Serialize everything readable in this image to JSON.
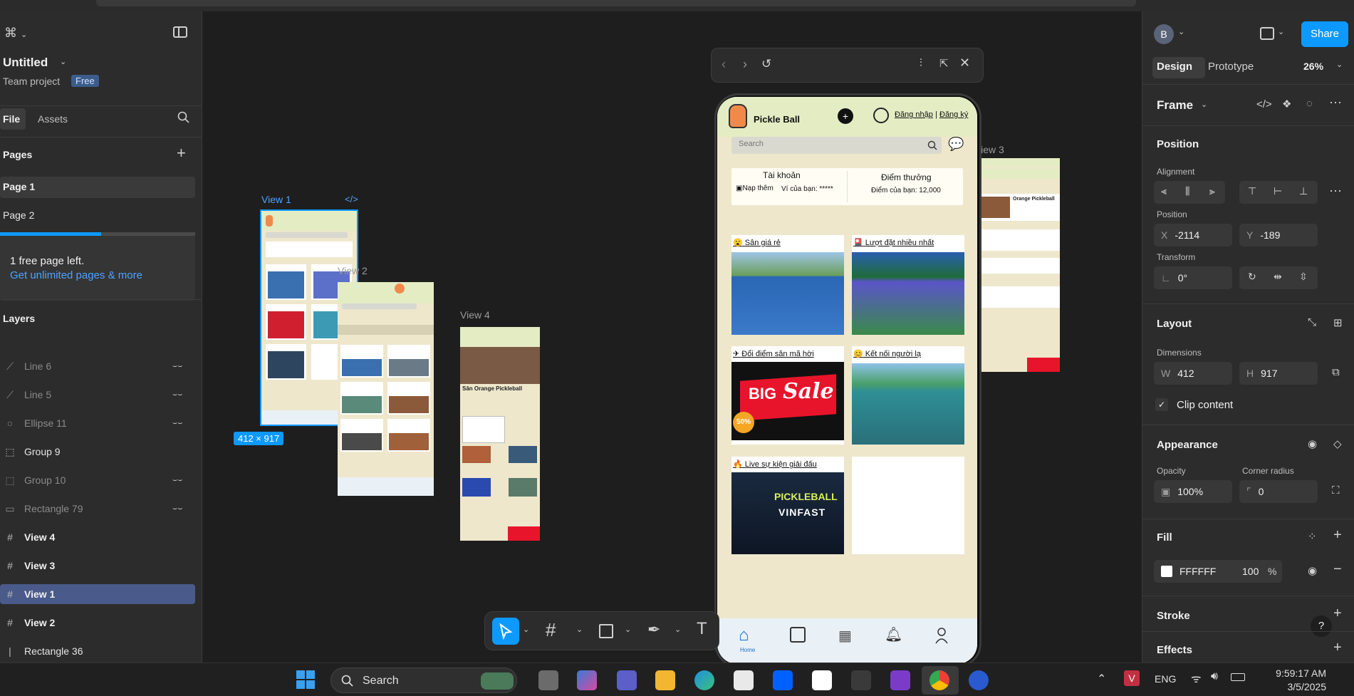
{
  "left_panel": {
    "file_name": "Untitled",
    "team": "Team project",
    "plan_badge": "Free",
    "tabs": [
      "File",
      "Assets"
    ],
    "pages_title": "Pages",
    "pages": [
      "Page 1",
      "Page 2"
    ],
    "notice": "1 free page left.",
    "notice_link": "Get unlimited pages & more",
    "usage_fraction": 0.52,
    "layers_title": "Layers",
    "layers": [
      {
        "icon": "line-icon",
        "glyph": "⟋",
        "label": "Line 6",
        "hidden": true,
        "bold": false
      },
      {
        "icon": "line-icon",
        "glyph": "⟋",
        "label": "Line 5",
        "hidden": true,
        "bold": false
      },
      {
        "icon": "ellipse-icon",
        "glyph": "○",
        "label": "Ellipse 11",
        "hidden": true,
        "bold": false
      },
      {
        "icon": "group-icon",
        "glyph": "⬚",
        "label": "Group 9",
        "hidden": false,
        "bold": false
      },
      {
        "icon": "group-icon",
        "glyph": "⬚",
        "label": "Group 10",
        "hidden": true,
        "bold": false
      },
      {
        "icon": "rectangle-icon",
        "glyph": "▭",
        "label": "Rectangle 79",
        "hidden": true,
        "bold": false
      },
      {
        "icon": "frame-icon",
        "glyph": "#",
        "label": "View 4",
        "hidden": false,
        "bold": true
      },
      {
        "icon": "frame-icon",
        "glyph": "#",
        "label": "View 3",
        "hidden": false,
        "bold": true
      },
      {
        "icon": "frame-icon",
        "glyph": "#",
        "label": "View 1",
        "hidden": false,
        "bold": true,
        "selected": true
      },
      {
        "icon": "frame-icon",
        "glyph": "#",
        "label": "View 2",
        "hidden": false,
        "bold": true
      },
      {
        "icon": "line-icon",
        "glyph": "|",
        "label": "Rectangle 36",
        "hidden": false,
        "bold": false
      }
    ]
  },
  "canvas": {
    "frames": {
      "view1": "View 1",
      "view2": "View 2",
      "view3": "View 3",
      "view4": "View 4"
    },
    "size_badge": "412 × 917",
    "code_icon": "</>",
    "view4_title": "Sân Orange Pickleball",
    "view3_title": "Orange Pickleball"
  },
  "phone": {
    "brand": "Pickle Ball",
    "login": "Đăng nhập",
    "separator": "|",
    "register": "Đăng ký",
    "search_placeholder": "Search",
    "account_title": "Tài khoản",
    "topup": "Nạp thêm",
    "wallet": "Ví của bạn: *****",
    "points_title": "Điểm thưởng",
    "points_value": "Điểm của bạn: 12,000",
    "cards": [
      {
        "title": "Sân giá rẻ",
        "emoji": "😮"
      },
      {
        "title": "Lượt đặt nhiều nhất",
        "emoji": "🎴"
      },
      {
        "title": "Đổi điểm săn mã hời",
        "emoji": "✈"
      },
      {
        "title": "Kết nối người lạ",
        "emoji": "😊"
      },
      {
        "title": "Live sự kiện giải đấu",
        "emoji": "🔥"
      }
    ],
    "sale_big": "BIG",
    "sale_word": "Sale",
    "sale_pct": "50%",
    "event_line1": "PICKLEBALL",
    "event_line2": "VINFAST",
    "nav_home": "Home"
  },
  "right_panel": {
    "avatar_letter": "B",
    "share": "Share",
    "tabs": [
      "Design",
      "Prototype"
    ],
    "zoom": "26%",
    "frame_label": "Frame",
    "position_title": "Position",
    "alignment_label": "Alignment",
    "position_label": "Position",
    "x_prefix": "X",
    "x_value": "-2114",
    "y_prefix": "Y",
    "y_value": "-189",
    "transform_label": "Transform",
    "rotation": "0°",
    "layout_title": "Layout",
    "dimensions_label": "Dimensions",
    "w_prefix": "W",
    "w_value": "412",
    "h_prefix": "H",
    "h_value": "917",
    "clip_label": "Clip content",
    "appearance_title": "Appearance",
    "opacity_label": "Opacity",
    "opacity_value": "100%",
    "radius_label": "Corner radius",
    "radius_value": "0",
    "fill_title": "Fill",
    "fill_hex": "FFFFFF",
    "fill_opacity": "100",
    "fill_pct": "%",
    "stroke_title": "Stroke",
    "effects_title": "Effects",
    "help": "?"
  },
  "taskbar": {
    "search": "Search",
    "lang": "ENG",
    "time": "9:59:17 AM",
    "date": "3/5/2025"
  },
  "colors": {
    "accent": "#0d99ff",
    "selection": "#4a5a8a",
    "phone_bg": "#eee7cc",
    "header_green": "#e4ecc4",
    "sale_red": "#e8142b"
  }
}
